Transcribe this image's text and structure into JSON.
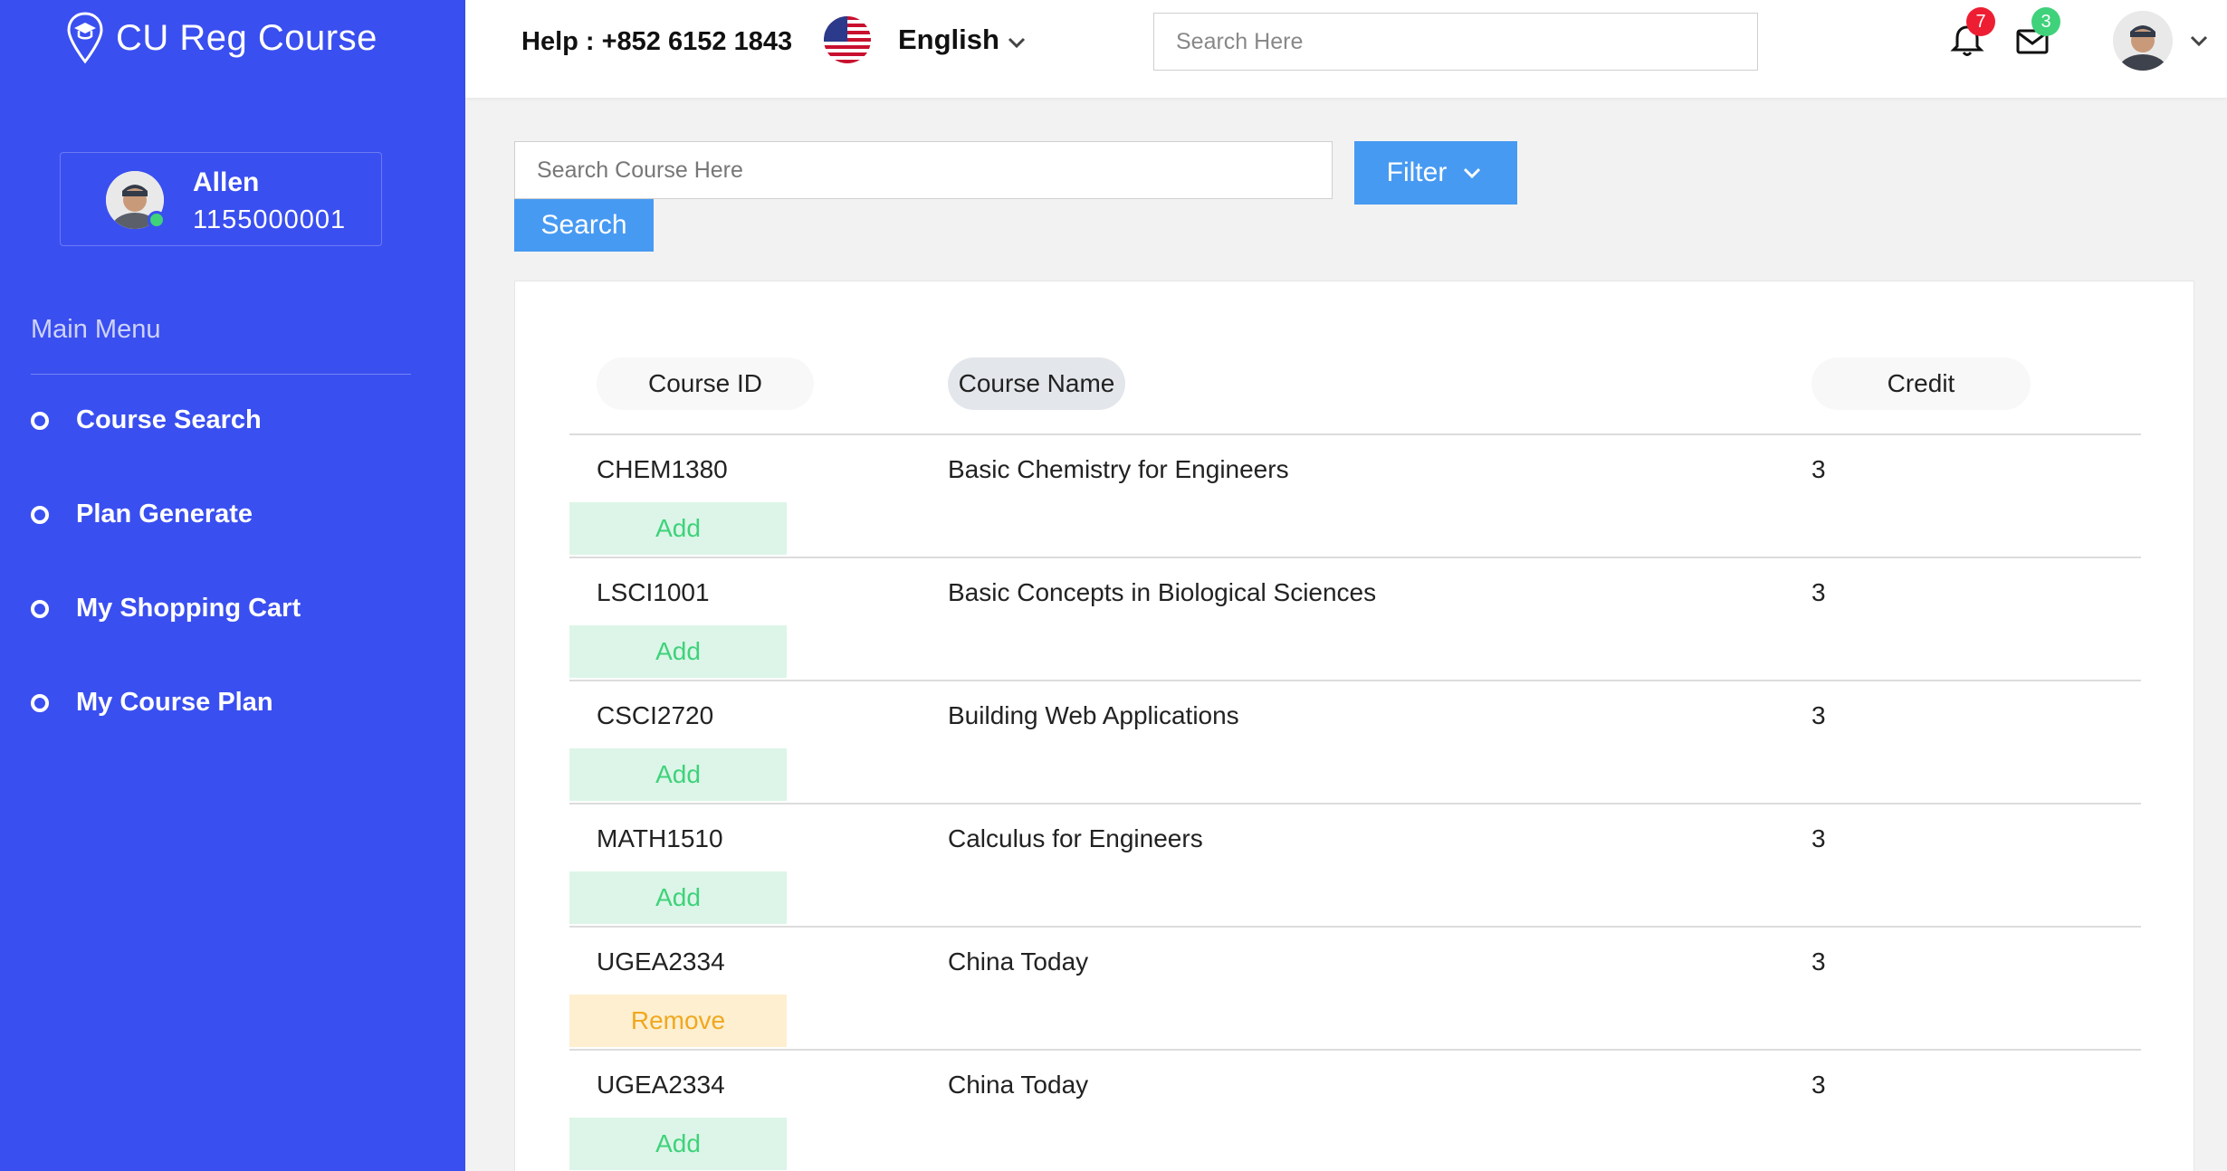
{
  "app": {
    "title": "CU Reg Course"
  },
  "sidebar": {
    "profile": {
      "name": "Allen",
      "id": "1155000001"
    },
    "menu_title": "Main Menu",
    "items": [
      {
        "label": "Course Search"
      },
      {
        "label": "Plan Generate"
      },
      {
        "label": "My Shopping Cart"
      },
      {
        "label": "My Course Plan"
      }
    ]
  },
  "header": {
    "help": "Help : +852 6152 1843",
    "language": "English",
    "search_placeholder": "Search Here",
    "notifications_count": "7",
    "messages_count": "3"
  },
  "course_search": {
    "placeholder": "Search Course Here",
    "filter_label": "Filter",
    "search_label": "Search"
  },
  "table": {
    "headers": {
      "course_id": "Course ID",
      "course_name": "Course Name",
      "credit": "Credit"
    },
    "rows": [
      {
        "id": "CHEM1380",
        "name": "Basic Chemistry for Engineers",
        "credit": "3",
        "action": "Add"
      },
      {
        "id": "LSCI1001",
        "name": "Basic Concepts in Biological Sciences",
        "credit": "3",
        "action": "Add"
      },
      {
        "id": "CSCI2720",
        "name": "Building Web Applications",
        "credit": "3",
        "action": "Add"
      },
      {
        "id": "MATH1510",
        "name": "Calculus for Engineers",
        "credit": "3",
        "action": "Add"
      },
      {
        "id": "UGEA2334",
        "name": "China Today",
        "credit": "3",
        "action": "Remove"
      },
      {
        "id": "UGEA2334",
        "name": "China Today",
        "credit": "3",
        "action": "Add"
      }
    ]
  },
  "colors": {
    "sidebar": "#3a4ff0",
    "primary_button": "#479af2",
    "add_bg": "#dcf5e8",
    "add_text": "#3fd27a",
    "remove_bg": "#fdefd0",
    "remove_text": "#f0a820",
    "badge_red": "#ee1e32",
    "badge_green": "#3fd27a"
  },
  "icons": {
    "logo": "graduation-cap-pin-icon",
    "language_flag": "us-flag-icon",
    "notifications": "bell-icon",
    "messages": "envelope-icon",
    "dropdown": "chevron-down-icon"
  }
}
